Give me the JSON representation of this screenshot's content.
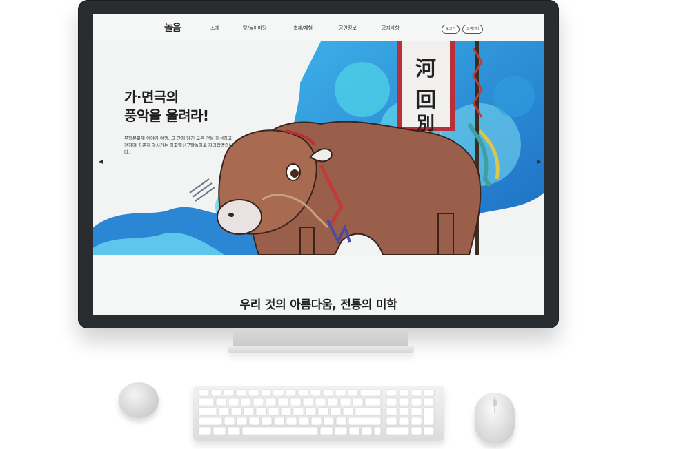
{
  "nav": {
    "logo": "놀음",
    "menu": [
      "소개",
      "탈/놀이마당",
      "축제/체험",
      "공연정보",
      "공지사항"
    ],
    "login_label": "로그인",
    "customer_center_label": "고객센터"
  },
  "hero": {
    "title_line1": "가·면극의",
    "title_line2": "풍악을 울려라!",
    "description": "무형문화재 이야기 여행, 그 안에 담긴 모든 것을 해석하고 전하며 꾸준히 앞서가는 하회별신굿탈놀이로 자리잡겠습니다.",
    "banner_text": "河回別",
    "prev_arrow": "◀",
    "next_arrow": "▶"
  },
  "section": {
    "title": "우리 것의 아름다움, 전통의 미학"
  },
  "colors": {
    "accent_blue": "#1e88d6",
    "accent_cyan": "#4fd1e6",
    "banner_red": "#b8313a",
    "bull_brown": "#9a5f4a"
  }
}
